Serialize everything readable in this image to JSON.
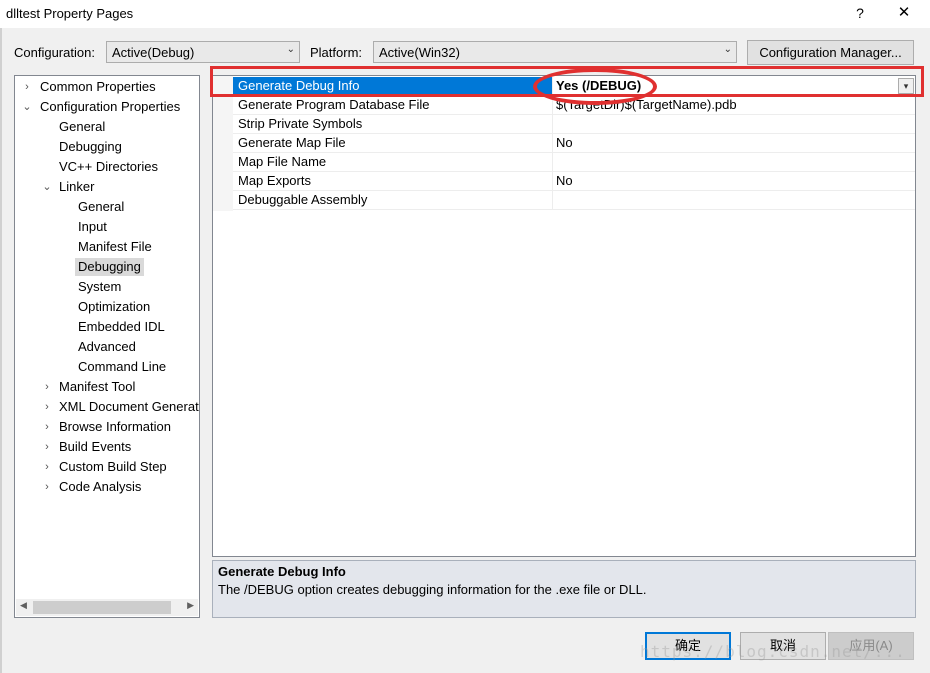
{
  "window": {
    "title": "dlltest Property Pages",
    "help_label": "?",
    "close_label": "✕"
  },
  "toolbar": {
    "configuration_label": "Configuration:",
    "configuration_value": "Active(Debug)",
    "platform_label": "Platform:",
    "platform_value": "Active(Win32)",
    "config_manager_label": "Configuration Manager..."
  },
  "tree": {
    "items": [
      {
        "label": "Common Properties",
        "expander": "›"
      },
      {
        "label": "Configuration Properties",
        "expander": "⌄"
      },
      {
        "label": "General"
      },
      {
        "label": "Debugging"
      },
      {
        "label": "VC++ Directories"
      },
      {
        "label": "Linker",
        "expander": "⌄"
      },
      {
        "label": "General"
      },
      {
        "label": "Input"
      },
      {
        "label": "Manifest File"
      },
      {
        "label": "Debugging",
        "selected": true
      },
      {
        "label": "System"
      },
      {
        "label": "Optimization"
      },
      {
        "label": "Embedded IDL"
      },
      {
        "label": "Advanced"
      },
      {
        "label": "Command Line"
      },
      {
        "label": "Manifest Tool",
        "expander": "›"
      },
      {
        "label": "XML Document Generat",
        "expander": "›"
      },
      {
        "label": "Browse Information",
        "expander": "›"
      },
      {
        "label": "Build Events",
        "expander": "›"
      },
      {
        "label": "Custom Build Step",
        "expander": "›"
      },
      {
        "label": "Code Analysis",
        "expander": "›"
      }
    ],
    "scroll_left": "◀",
    "scroll_right": "▶"
  },
  "grid": {
    "rows": [
      {
        "name": "Generate Debug Info",
        "value": "Yes (/DEBUG)",
        "selected": true
      },
      {
        "name": "Generate Program Database File",
        "value": "$(TargetDir)$(TargetName).pdb"
      },
      {
        "name": "Strip Private Symbols",
        "value": ""
      },
      {
        "name": "Generate Map File",
        "value": "No"
      },
      {
        "name": "Map File Name",
        "value": ""
      },
      {
        "name": "Map Exports",
        "value": "No"
      },
      {
        "name": "Debuggable Assembly",
        "value": ""
      }
    ],
    "dropdown_icon": "▾"
  },
  "description": {
    "title": "Generate Debug Info",
    "text": "The /DEBUG option creates debugging information for the .exe file or DLL."
  },
  "buttons": {
    "ok": "确定",
    "cancel": "取消",
    "apply": "应用(A)"
  },
  "watermark": "https://blog.csdn.net/...",
  "colors": {
    "selection": "#0078d7",
    "highlight": "#e03030"
  }
}
